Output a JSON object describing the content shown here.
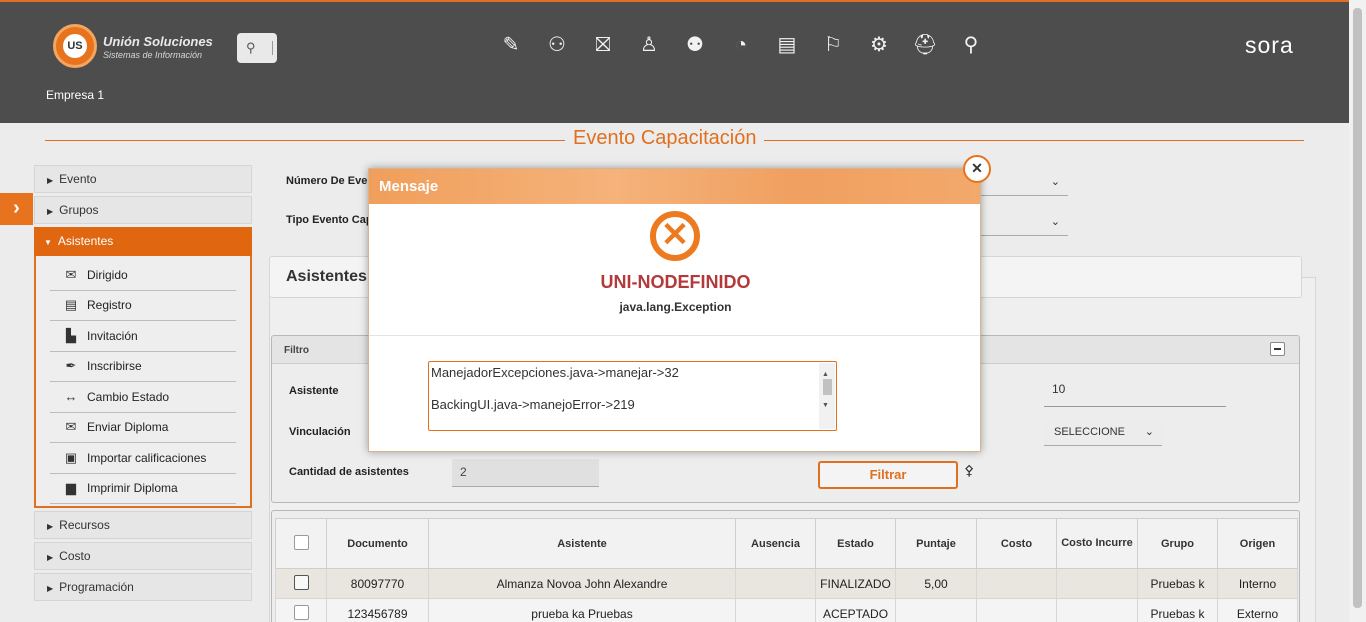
{
  "header": {
    "logo_name": "Unión Soluciones",
    "logo_sub": "Sistemas de Información",
    "logo_mark": "US",
    "search_icon": "search-icon",
    "module_icons": [
      "document-edit-icon",
      "user-shield-icon",
      "gift-icon",
      "org-chart-icon",
      "user-card-icon",
      "stopwatch-icon",
      "report-icon",
      "presenter-icon",
      "gears-icon",
      "medical-bag-icon",
      "search-people-icon"
    ],
    "module_glyphs": [
      "✎",
      "⚇",
      "⛝",
      "♙",
      "⚉",
      "◔",
      "▤",
      "⚐",
      "⚙",
      "⛑",
      "⚲"
    ],
    "brand": "sora",
    "empresa": "Empresa 1"
  },
  "page_title": "Evento Capacitación",
  "sidebar": {
    "items_top": [
      {
        "label": "Evento"
      },
      {
        "label": "Grupos"
      }
    ],
    "active": {
      "label": "Asistentes"
    },
    "submenu": [
      {
        "label": "Dirigido",
        "icon": "envelope-icon",
        "glyph": "✉"
      },
      {
        "label": "Registro",
        "icon": "form-icon",
        "glyph": "▤"
      },
      {
        "label": "Invitación",
        "icon": "document-icon",
        "glyph": "▙"
      },
      {
        "label": "Inscribirse",
        "icon": "pen-icon",
        "glyph": "✒"
      },
      {
        "label": "Cambio Estado",
        "icon": "arrows-icon",
        "glyph": "↔"
      },
      {
        "label": "Enviar Diploma",
        "icon": "mail-open-icon",
        "glyph": "✉"
      },
      {
        "label": "Importar calificaciones",
        "icon": "import-icon",
        "glyph": "▣"
      },
      {
        "label": "Imprimir Diploma",
        "icon": "printer-icon",
        "glyph": "▆"
      }
    ],
    "items_bottom": [
      {
        "label": "Recursos"
      },
      {
        "label": "Costo"
      },
      {
        "label": "Programación"
      }
    ]
  },
  "form": {
    "numero_label": "Número De Eve",
    "tipo_label": "Tipo Evento Cap"
  },
  "asistentes_panel": {
    "title": "Asistentes"
  },
  "filtro": {
    "title": "Filtro",
    "asistente_label": "Asistente",
    "vinculacion_label": "Vinculación",
    "cantidad_label": "Cantidad de asistentes",
    "cantidad_value": "2",
    "right_value": "10",
    "select_value": "SELECCIONE",
    "filtrar_button": "Filtrar"
  },
  "table": {
    "headers": [
      "Documento",
      "Asistente",
      "Ausencia",
      "Estado",
      "Puntaje",
      "Costo",
      "Costo Incurre",
      "Grupo",
      "Origen"
    ],
    "rows": [
      {
        "documento": "80097770",
        "asistente": "Almanza Novoa John Alexandre",
        "ausencia": "",
        "estado": "FINALIZADO",
        "puntaje": "5,00",
        "costo": "",
        "costo_incurre": "",
        "grupo": "Pruebas k",
        "origen": "Interno"
      },
      {
        "documento": "123456789",
        "asistente": "prueba ka Pruebas",
        "ausencia": "",
        "estado": "ACEPTADO",
        "puntaje": "",
        "costo": "",
        "costo_incurre": "",
        "grupo": "Pruebas k",
        "origen": "Externo"
      }
    ]
  },
  "modal": {
    "title": "Mensaje",
    "code": "UNI-NODEFINIDO",
    "exception": "java.lang.Exception",
    "trace_line1": "ManejadorExcepciones.java->manejar->32",
    "trace_line2": "BackingUI.java->manejoError->219"
  },
  "colors": {
    "accent": "#e07020",
    "header_bg": "#4d4d4d",
    "error_text": "#b23a3a"
  }
}
